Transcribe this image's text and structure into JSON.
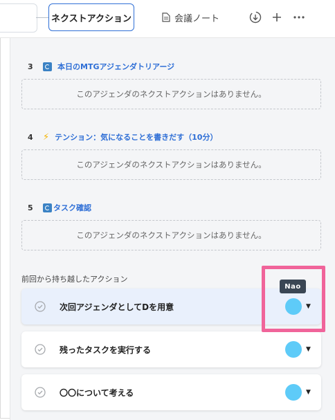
{
  "tabs": {
    "next_action": "ネクストアクション",
    "meeting_notes": "会議ノート"
  },
  "toolbar": {
    "download_icon": "download-icon",
    "add_icon": "plus-icon",
    "more_icon": "more-icon"
  },
  "agenda": [
    {
      "num": "3",
      "icon": "repeat-emoji",
      "title": "本日のMTGアジェンダトリアージ",
      "empty_text": "このアジェンダのネクストアクションはありません。"
    },
    {
      "num": "4",
      "icon": "lightning-emoji",
      "title": "テンション：気になることを書きだす（10分）",
      "empty_text": "このアジェンダのネクストアクションはありません。"
    },
    {
      "num": "5",
      "icon": "repeat-emoji",
      "title": "タスク確認",
      "empty_text": "このアジェンダのネクストアクションはありません。"
    }
  ],
  "carried_over": {
    "label": "前回から持ち越したアクション",
    "items": [
      {
        "text": "次回アジェンダとしてDを用意"
      },
      {
        "text": "残ったタスクを実行する"
      },
      {
        "text": "〇〇について考える"
      }
    ]
  },
  "tooltip": {
    "text": "Nao"
  },
  "colors": {
    "accent": "#2f6fd6",
    "avatar": "#5ecbf8",
    "highlight": "#f0649a",
    "hover_card": "#e9f0fc"
  }
}
